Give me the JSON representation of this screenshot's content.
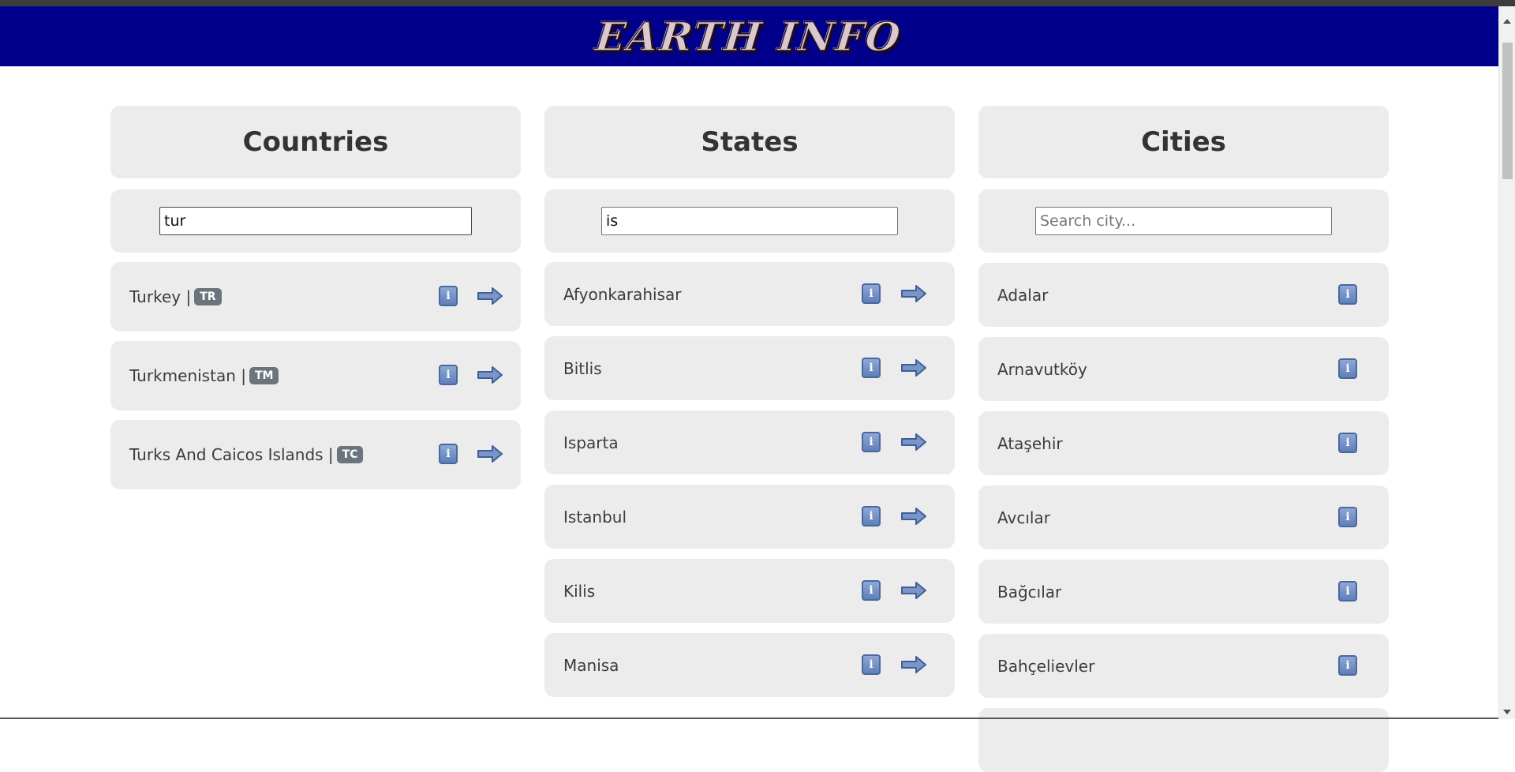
{
  "header": {
    "logo_text": "EARTH INFO"
  },
  "countries": {
    "title": "Countries",
    "search_value": "tur",
    "items": [
      {
        "name": "Turkey |",
        "code": "TR"
      },
      {
        "name": "Turkmenistan |",
        "code": "TM"
      },
      {
        "name": "Turks And Caicos Islands |",
        "code": "TC"
      }
    ]
  },
  "states": {
    "title": "States",
    "search_value": "is",
    "items": [
      {
        "name": "Afyonkarahisar"
      },
      {
        "name": "Bitlis"
      },
      {
        "name": "Isparta"
      },
      {
        "name": "Istanbul"
      },
      {
        "name": "Kilis"
      },
      {
        "name": "Manisa"
      }
    ]
  },
  "cities": {
    "title": "Cities",
    "search_placeholder": "Search city...",
    "items": [
      {
        "name": "Adalar"
      },
      {
        "name": "Arnavutköy"
      },
      {
        "name": "Ataşehir"
      },
      {
        "name": "Avcılar"
      },
      {
        "name": "Bağcılar"
      },
      {
        "name": "Bahçelievler"
      }
    ]
  },
  "icons": {
    "info": "info-icon",
    "arrow": "arrow-right-icon"
  },
  "colors": {
    "header_bg": "#00008c",
    "panel_bg": "#ececec",
    "badge_bg": "#6c757d",
    "icon_blue": "#5e7fb8"
  }
}
